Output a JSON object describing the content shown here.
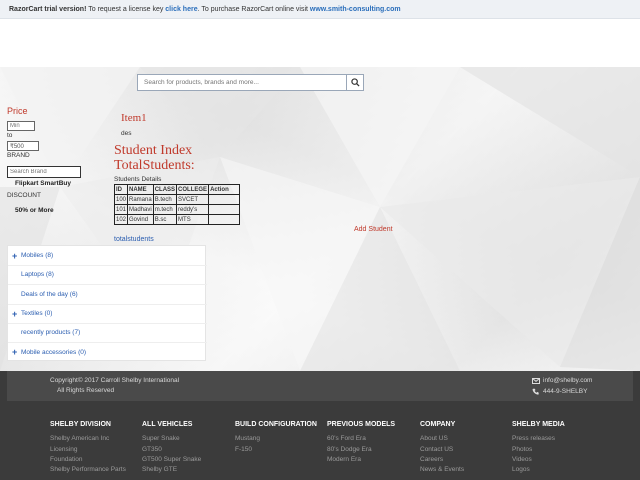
{
  "trial_bar": {
    "prefix": "RazorCart trial version!",
    "request_text": " To request a license key ",
    "click_here": "click here",
    "purchase_text": ". To purchase RazorCart online visit ",
    "site_link": "www.smith-consulting.com"
  },
  "search": {
    "placeholder": "Search for products, brands and more..."
  },
  "filters": {
    "price_title": "Price",
    "min_placeholder": "Min",
    "to_label": "to",
    "max_value": "₹500",
    "brand_label": "BRAND",
    "brand_placeholder": "Search Brand",
    "brand_option": "Flipkart SmartBuy",
    "discount_label": "DISCOUNT",
    "discount_option": "50% or More"
  },
  "item": {
    "title": "Item1",
    "description": "des"
  },
  "students": {
    "heading": "Student Index",
    "total_heading": "TotalStudents:",
    "details_label": "Students Details",
    "columns": [
      "ID",
      "NAME",
      "CLASS",
      "COLLEGE",
      "Action"
    ],
    "rows": [
      [
        "100",
        "Ramana",
        "B.tech",
        "SVCET",
        ""
      ],
      [
        "101",
        "Madhavi",
        "m.tech",
        "reddy's",
        ""
      ],
      [
        "102",
        "Govind",
        "B.sc",
        "MTS",
        ""
      ]
    ],
    "add_student": "Add Student",
    "total_link": "totalstudents"
  },
  "categories": [
    {
      "label": "Mobiles (8)",
      "plus": true
    },
    {
      "label": "Laptops (8)",
      "plus": false
    },
    {
      "label": "Deals of the day (6)",
      "plus": false
    },
    {
      "label": "Textiles (0)",
      "plus": true
    },
    {
      "label": "recently products (7)",
      "plus": false
    },
    {
      "label": "Mobile accessories (0)",
      "plus": true
    }
  ],
  "footer": {
    "copyright_line1": "Copyright© 2017 Carroll Shelby International",
    "copyright_line2": "All Rights Reserved",
    "email": "info@shelby.com",
    "phone": "444-9-SHELBY",
    "columns": [
      {
        "title": "SHELBY DIVISION",
        "links": [
          "Shelby American Inc",
          "Licensing",
          "Foundation",
          "Shelby Performance Parts"
        ]
      },
      {
        "title": "ALL VEHICLES",
        "links": [
          "Super Snake",
          "GT350",
          "GT500 Super Snake",
          "Shelby GTE"
        ]
      },
      {
        "title": "BUILD CONFIGURATION",
        "links": [
          "Mustang",
          "F-150"
        ]
      },
      {
        "title": "PREVIOUS MODELS",
        "links": [
          "60's Ford Era",
          "80's Dodge Era",
          "Modern Era"
        ]
      },
      {
        "title": "COMPANY",
        "links": [
          "About US",
          "Contact US",
          "Careers",
          "News & Events"
        ]
      },
      {
        "title": "SHELBY MEDIA",
        "links": [
          "Press releases",
          "Photos",
          "Videos",
          "Logos"
        ]
      }
    ]
  },
  "colors": {
    "accent_red": "#c0392b",
    "link_blue": "#2a5db0",
    "footer_bg": "#3b3b3b"
  }
}
